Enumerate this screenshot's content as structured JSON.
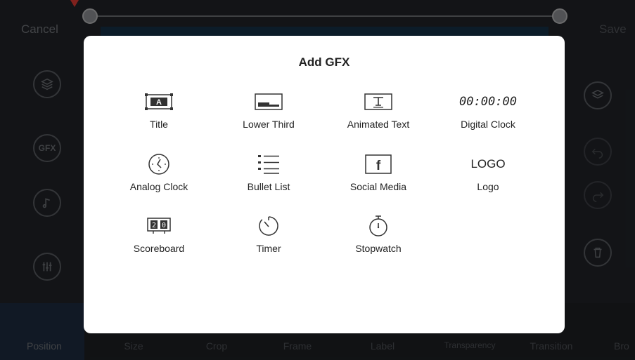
{
  "header": {
    "cancel_label": "Cancel",
    "save_label": "Save"
  },
  "dialog": {
    "title": "Add GFX",
    "items": [
      {
        "label": "Title",
        "icon": "title-icon"
      },
      {
        "label": "Lower Third",
        "icon": "lower-third-icon"
      },
      {
        "label": "Animated Text",
        "icon": "animated-text-icon"
      },
      {
        "label": "Digital Clock",
        "icon": "digital-clock-icon",
        "icon_text": "00:00:00"
      },
      {
        "label": "Analog Clock",
        "icon": "analog-clock-icon"
      },
      {
        "label": "Bullet List",
        "icon": "bullet-list-icon"
      },
      {
        "label": "Social Media",
        "icon": "social-media-icon"
      },
      {
        "label": "Logo",
        "icon": "logo-icon",
        "icon_text": "LOGO"
      },
      {
        "label": "Scoreboard",
        "icon": "scoreboard-icon"
      },
      {
        "label": "Timer",
        "icon": "timer-icon"
      },
      {
        "label": "Stopwatch",
        "icon": "stopwatch-icon"
      }
    ]
  },
  "sidebar": {
    "gfx_label": "GFX"
  },
  "toolbar": {
    "tools": [
      "Position",
      "Size",
      "Crop",
      "Frame",
      "Label",
      "Transparency",
      "Transition",
      "Bro"
    ]
  },
  "colors": {
    "background": "#1b1d20",
    "dialog": "#ffffff",
    "marker": "#e0342b"
  }
}
